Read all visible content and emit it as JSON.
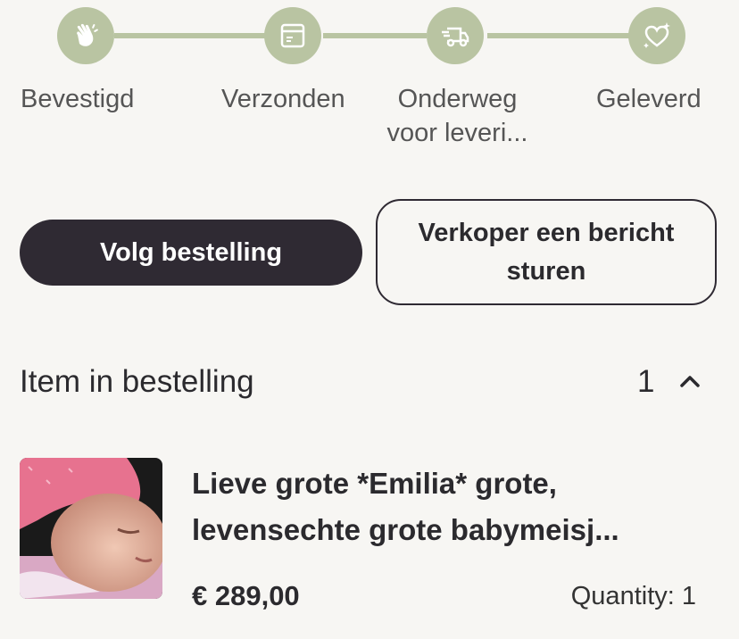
{
  "tracker": {
    "steps": [
      {
        "label": "Bevestigd",
        "icon": "waving-hand-icon"
      },
      {
        "label": "Verzonden",
        "icon": "package-icon"
      },
      {
        "label": "Onderweg voor leveri...",
        "icon": "delivery-truck-icon"
      },
      {
        "label": "Geleverd",
        "icon": "heart-sparkle-icon"
      }
    ],
    "color": "#b9c4a2"
  },
  "actions": {
    "track_order": "Volg bestelling",
    "message_seller": "Verkoper een bericht sturen"
  },
  "items_section": {
    "title": "Item in bestelling",
    "count": "1",
    "toggle_icon": "chevron-up-icon"
  },
  "item": {
    "title": "Lieve grote *Emilia* grote, levensechte grote babymeisj...",
    "price": "€ 289,00",
    "quantity": "Quantity: 1",
    "image_icon": "product-thumbnail"
  },
  "colors": {
    "background": "#f7f6f3",
    "primary_button": "#2f2a33",
    "accent": "#b9c4a2"
  }
}
